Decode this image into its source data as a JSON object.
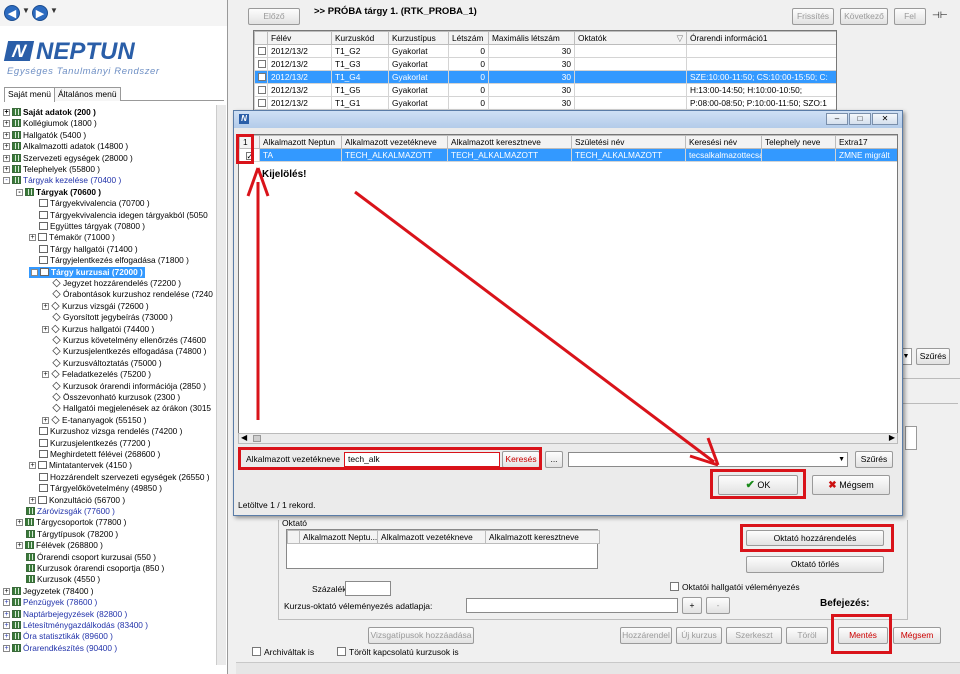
{
  "nav": {
    "back": "◀",
    "forward": "▶",
    "drop": "▼"
  },
  "logo": {
    "mark": "N",
    "name": "NEPTUN",
    "subtitle": "Egységes Tanulmányi Rendszer"
  },
  "left_tabs": [
    "Saját menü",
    "Általános menü"
  ],
  "tree": [
    {
      "t": "Saját adatok  (200  )",
      "d": 0,
      "ex": "+",
      "ic": "grid",
      "st": "bold"
    },
    {
      "t": "Kollégiumok (1800 )",
      "d": 0,
      "ex": "+",
      "ic": "grid"
    },
    {
      "t": "Hallgatók (5400 )",
      "d": 0,
      "ex": "+",
      "ic": "grid"
    },
    {
      "t": "Alkalmazotti adatok (14800 )",
      "d": 0,
      "ex": "+",
      "ic": "grid"
    },
    {
      "t": "Szervezeti egységek (28000 )",
      "d": 0,
      "ex": "+",
      "ic": "grid"
    },
    {
      "t": "Telephelyek (55800 )",
      "d": 0,
      "ex": "+",
      "ic": "grid"
    },
    {
      "t": "Tárgyak kezelése (70400 )",
      "d": 0,
      "ex": "-",
      "ic": "grid",
      "st": "blue"
    },
    {
      "t": "Tárgyak (70600 )",
      "d": 1,
      "ex": "-",
      "ic": "grid",
      "st": "bold"
    },
    {
      "t": "Tárgyekvivalencia (70700 )",
      "d": 2,
      "ic": "doc"
    },
    {
      "t": "Tárgyekvivalencia idegen tárgyakból (5050",
      "d": 2,
      "ic": "doc"
    },
    {
      "t": "Együttes tárgyak (70800 )",
      "d": 2,
      "ic": "doc"
    },
    {
      "t": "Témakör (71000 )",
      "d": 2,
      "ex": "+",
      "ic": "doc"
    },
    {
      "t": "Tárgy hallgatói (71400 )",
      "d": 2,
      "ic": "doc"
    },
    {
      "t": "Tárgyjelentkezés elfogadása (71800 )",
      "d": 2,
      "ic": "doc"
    },
    {
      "t": "Tárgy kurzusai (72000 )",
      "d": 2,
      "ex": "-",
      "ic": "doc",
      "st": "sel"
    },
    {
      "t": "Jegyzet hozzárendelés (72200 )",
      "d": 3,
      "ic": "diamond"
    },
    {
      "t": "Órabontások kurzushoz rendelése (7240",
      "d": 3,
      "ic": "diamond"
    },
    {
      "t": "Kurzus vizsgái (72600 )",
      "d": 3,
      "ex": "+",
      "ic": "diamond"
    },
    {
      "t": "Gyorsított jegybeírás (73000 )",
      "d": 3,
      "ic": "diamond"
    },
    {
      "t": "Kurzus hallgatói (74400 )",
      "d": 3,
      "ex": "+",
      "ic": "diamond"
    },
    {
      "t": "Kurzus követelmény ellenőrzés (74600",
      "d": 3,
      "ic": "diamond"
    },
    {
      "t": "Kurzusjelentkezés elfogadása (74800 )",
      "d": 3,
      "ic": "diamond"
    },
    {
      "t": "Kurzusváltoztatás (75000 )",
      "d": 3,
      "ic": "diamond"
    },
    {
      "t": "Feladatkezelés (75200 )",
      "d": 3,
      "ex": "+",
      "ic": "diamond"
    },
    {
      "t": "Kurzusok órarendi információja (2850 )",
      "d": 3,
      "ic": "diamond"
    },
    {
      "t": "Összevonható kurzusok (2300 )",
      "d": 3,
      "ic": "diamond"
    },
    {
      "t": "Hallgatói megjelenések az órákon (3015",
      "d": 3,
      "ic": "diamond"
    },
    {
      "t": "E-tananyagok (55150 )",
      "d": 3,
      "ex": "+",
      "ic": "diamond"
    },
    {
      "t": "Kurzushoz vizsga rendelés (74200 )",
      "d": 2,
      "ic": "doc"
    },
    {
      "t": "Kurzusjelentkezés (77200 )",
      "d": 2,
      "ic": "doc"
    },
    {
      "t": "Meghirdetett félévei (268600 )",
      "d": 2,
      "ic": "doc"
    },
    {
      "t": "Mintatantervek (4150 )",
      "d": 2,
      "ex": "+",
      "ic": "doc"
    },
    {
      "t": "Hozzárendelt szervezeti egységek (26550 )",
      "d": 2,
      "ic": "doc"
    },
    {
      "t": "Tárgyelőkövetelmény (49850 )",
      "d": 2,
      "ic": "doc"
    },
    {
      "t": "Konzultáció (56700 )",
      "d": 2,
      "ex": "+",
      "ic": "doc"
    },
    {
      "t": "Záróvizsgák (77600 )",
      "d": 1,
      "ic": "grid",
      "st": "blue"
    },
    {
      "t": "Tárgycsoportok (77800 )",
      "d": 1,
      "ex": "+",
      "ic": "grid"
    },
    {
      "t": "Tárgytípusok (78200 )",
      "d": 1,
      "ic": "grid"
    },
    {
      "t": "Félévek (268800 )",
      "d": 1,
      "ex": "+",
      "ic": "grid"
    },
    {
      "t": "Órarendi csoport kurzusai (550 )",
      "d": 1,
      "ic": "grid"
    },
    {
      "t": "Kurzusok órarendi csoportja (850 )",
      "d": 1,
      "ic": "grid"
    },
    {
      "t": "Kurzusok (4550 )",
      "d": 1,
      "ic": "grid"
    },
    {
      "t": "Jegyzetek (78400 )",
      "d": 0,
      "ex": "+",
      "ic": "grid"
    },
    {
      "t": "Pénzügyek (78600 )",
      "d": 0,
      "ex": "+",
      "ic": "grid",
      "st": "blue"
    },
    {
      "t": "Naptárbejegyzések (82800 )",
      "d": 0,
      "ex": "+",
      "ic": "grid",
      "st": "blue"
    },
    {
      "t": "Létesítménygazdálkodás (83400 )",
      "d": 0,
      "ex": "+",
      "ic": "grid",
      "st": "blue"
    },
    {
      "t": "Óra statisztikák (89600 )",
      "d": 0,
      "ex": "+",
      "ic": "grid",
      "st": "blue"
    },
    {
      "t": "Órarendkészítés (90400 )",
      "d": 0,
      "ex": "+",
      "ic": "grid",
      "st": "blue"
    }
  ],
  "toolbar": {
    "prev": "Előző",
    "caption": ">> PRÓBA tárgy 1. (RTK_PROBA_1)",
    "refresh": "Frissítés",
    "next": "Következő",
    "up": "Fel",
    "pin": "⊣⊢"
  },
  "course_grid": {
    "columns": [
      "",
      "Félév",
      "Kurzuskód",
      "Kurzustípus",
      "Létszám",
      "Maximális létszám",
      "Oktatók",
      "Órarendi információ1"
    ],
    "sort_indicator": "▽",
    "rows": [
      [
        "2012/13/2",
        "T1_G2",
        "Gyakorlat",
        "0",
        "30",
        "",
        ""
      ],
      [
        "2012/13/2",
        "T1_G3",
        "Gyakorlat",
        "0",
        "30",
        "",
        ""
      ],
      [
        "2012/13/2",
        "T1_G4",
        "Gyakorlat",
        "0",
        "30",
        "",
        "SZE:10:00-11:50; CS:10:00-15:50; C:"
      ],
      [
        "2012/13/2",
        "T1_G5",
        "Gyakorlat",
        "0",
        "30",
        "",
        "H:13:00-14:50; H:10:00-10:50;"
      ],
      [
        "2012/13/2",
        "T1_G1",
        "Gyakorlat",
        "0",
        "30",
        "",
        "P:08:00-08:50; P:10:00-11:50; SZO:1"
      ]
    ],
    "selected_row": 2
  },
  "dialog": {
    "icon": "N",
    "win_min": "–",
    "win_max": "□",
    "win_close": "✕",
    "columns": [
      "1",
      "Alkalmazott Neptun",
      "Alkalmazott vezetékneve",
      "Alkalmazott keresztneve",
      "Születési név",
      "Keresési név",
      "Telephely neve",
      "Extra17"
    ],
    "row": [
      "TA",
      "TECH_ALKALMAZOTT",
      "TECH_ALKALMAZOTT",
      "TECH_ALKALMAZOTT",
      "tecsalkalmazottecsa",
      "",
      "ZMNE migrált"
    ],
    "annotation": "Kijelölés!",
    "filter_field": "Alkalmazott vezetékneve",
    "filter_value": "tech_alk",
    "search": "Keresés",
    "more": "...",
    "filter_btn": "Szűrés",
    "ok": "OK",
    "cancel": "Mégsem",
    "status": "Letöltve 1 / 1 rekord."
  },
  "right_side": {
    "filter_btn": "Szűrés"
  },
  "oktato": {
    "legend": "Oktató",
    "columns": [
      "Alkalmazott Neptu...",
      "Alkalmazott vezetékneve",
      "Alkalmazott keresztneve"
    ],
    "assign_btn": "Oktató hozzárendelés",
    "delete_btn": "Oktató törlés",
    "percent_label": "Százalék:",
    "opinion_check": "Oktatói hallgatói véleményezés",
    "survey_label": "Kurzus-oktató véleményezés adatlapja:",
    "plus": "+",
    "minus": "-",
    "finish_label": "Befejezés:"
  },
  "bottom": {
    "room_types": "Vizsgatípusok hozzáadása",
    "timetable": "Hozzárendel",
    "new_course": "Új kurzus",
    "edit": "Szerkeszt",
    "delete": "Töröl",
    "save": "Mentés",
    "cancel": "Mégsem",
    "archived": "Archiváltak is",
    "deleted_links": "Törölt kapcsolatú kurzusok is"
  }
}
